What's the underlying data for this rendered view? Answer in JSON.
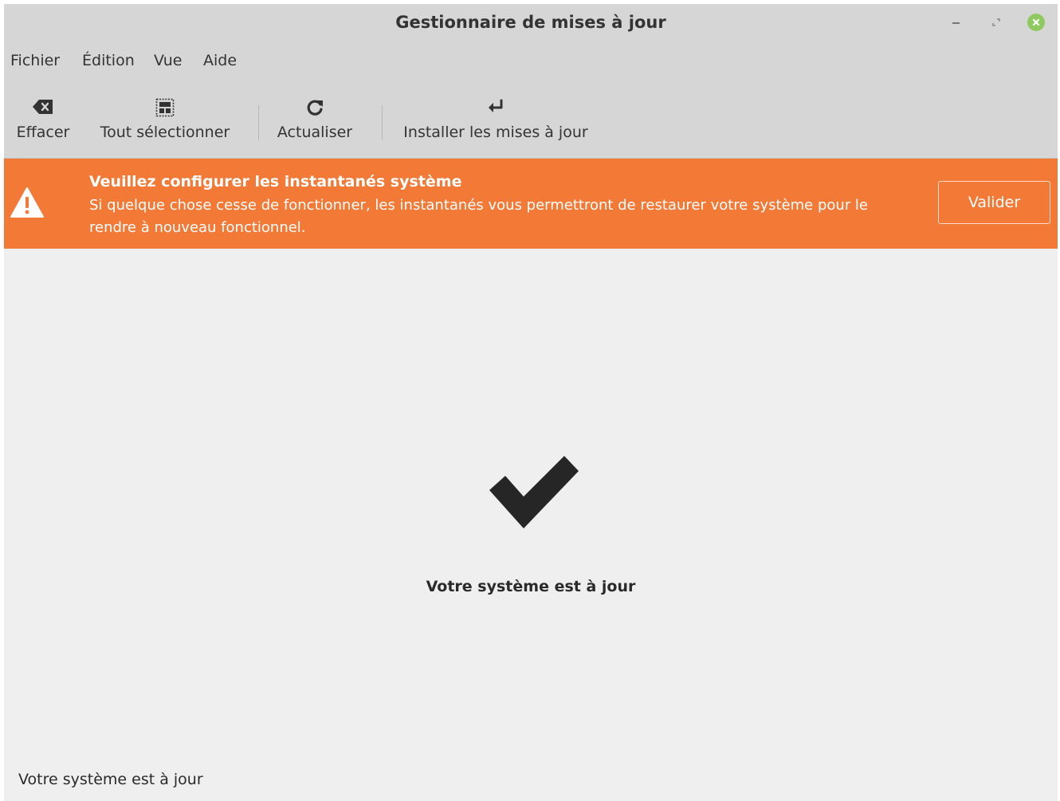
{
  "window": {
    "title": "Gestionnaire de mises à jour"
  },
  "menubar": {
    "items": [
      {
        "label": "Fichier"
      },
      {
        "label": "Édition"
      },
      {
        "label": "Vue"
      },
      {
        "label": "Aide"
      }
    ]
  },
  "toolbar": {
    "clear": {
      "label": "Effacer",
      "icon": "backspace-icon"
    },
    "select_all": {
      "label": "Tout sélectionner",
      "icon": "select-all-icon"
    },
    "refresh": {
      "label": "Actualiser",
      "icon": "refresh-icon"
    },
    "install": {
      "label": "Installer les mises à jour",
      "icon": "enter-arrow-icon"
    }
  },
  "infobar": {
    "title": "Veuillez configurer les instantanés système",
    "message": "Si quelque chose cesse de fonctionner, les instantanés vous permettront de restaurer votre système pour le rendre à nouveau fonctionnel.",
    "button_label": "Valider",
    "color": "#f27936"
  },
  "main": {
    "status": "Votre système est à jour"
  },
  "statusbar": {
    "text": "Votre système est à jour"
  }
}
